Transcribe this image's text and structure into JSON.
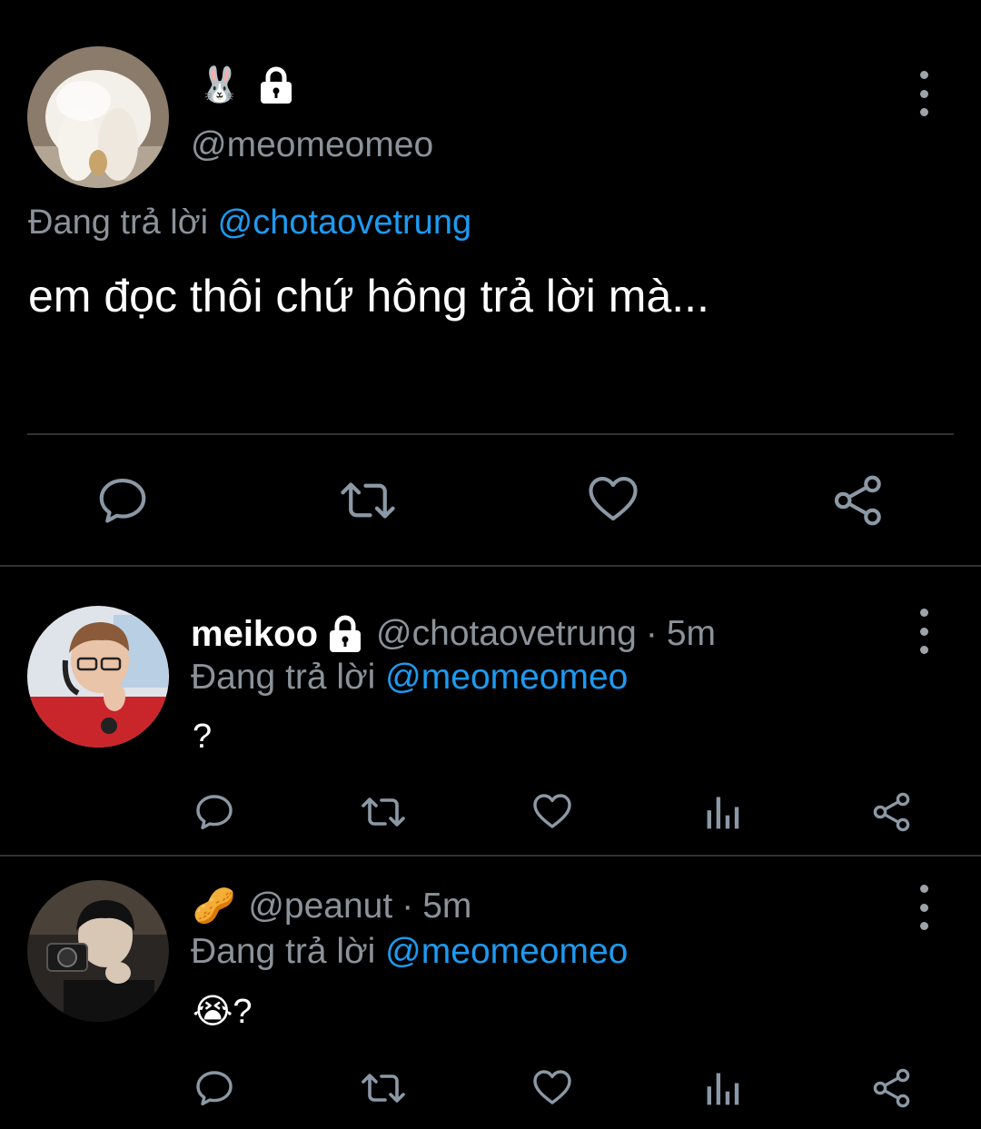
{
  "main_tweet": {
    "display_name_emoji": "🐰",
    "handle": "@meomeomeo",
    "replying_prefix": "Đang trả lời",
    "replying_to": "@chotaovetrung",
    "body": "em đọc thôi chứ hông trả lời mà...",
    "actions": [
      "reply-icon",
      "retweet-icon",
      "like-icon",
      "share-icon"
    ]
  },
  "replies": [
    {
      "display_name": "meikoo",
      "handle": "@chotaovetrung",
      "separator": "·",
      "time": "5m",
      "replying_prefix": "Đang trả lời",
      "replying_to": "@meomeomeo",
      "body": "?",
      "actions": [
        "reply-icon",
        "retweet-icon",
        "like-icon",
        "analytics-icon",
        "share-icon"
      ]
    },
    {
      "display_name_emoji": "🥜",
      "handle": "@peanut",
      "separator": "·",
      "time": "5m",
      "replying_prefix": "Đang trả lời",
      "replying_to": "@meomeomeo",
      "body_emoji": "😭",
      "body": "?",
      "actions": [
        "reply-icon",
        "retweet-icon",
        "like-icon",
        "analytics-icon",
        "share-icon"
      ]
    }
  ],
  "colors": {
    "background": "#000000",
    "text": "#e7e9ea",
    "secondary": "#8b9299",
    "link": "#1d9bf0",
    "icon": "#8b98a5",
    "divider": "#2f3336"
  }
}
